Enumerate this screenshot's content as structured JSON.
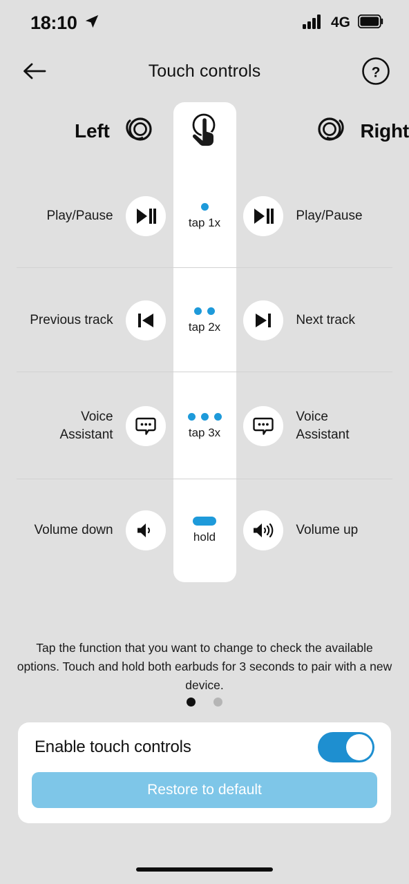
{
  "statusbar": {
    "time": "18:10",
    "location_icon": "location-arrow-icon",
    "signal_icon": "signal-bars-icon",
    "network": "4G",
    "battery_icon": "battery-full-icon"
  },
  "header": {
    "back_icon": "arrow-left-icon",
    "title": "Touch controls",
    "help_icon": "help-circle-icon"
  },
  "earbuds": {
    "left_label": "Left",
    "right_label": "Right",
    "left_icon": "earbud-icon",
    "right_icon": "earbud-icon",
    "gesture_header_icon": "tap-hand-icon"
  },
  "rows": [
    {
      "gesture": "tap 1x",
      "gesture_indicator": "one-blue-dot",
      "left_label": "Play/Pause",
      "left_icon": "play-pause-icon",
      "right_label": "Play/Pause",
      "right_icon": "play-pause-icon"
    },
    {
      "gesture": "tap 2x",
      "gesture_indicator": "two-blue-dots",
      "left_label": "Previous track",
      "left_icon": "previous-track-icon",
      "right_label": "Next track",
      "right_icon": "next-track-icon"
    },
    {
      "gesture": "tap 3x",
      "gesture_indicator": "three-blue-dots",
      "left_label": "Voice Assistant",
      "left_icon": "speech-bubble-icon",
      "right_label": "Voice Assistant",
      "right_icon": "speech-bubble-icon"
    },
    {
      "gesture": "hold",
      "gesture_indicator": "blue-pill",
      "left_label": "Volume down",
      "left_icon": "volume-down-icon",
      "right_label": "Volume up",
      "right_icon": "volume-up-icon"
    }
  ],
  "note": "Tap the function that you want to change to check the available options. Touch and hold both earbuds for 3 seconds to pair with a new device.",
  "pagination": {
    "total": 2,
    "active_index": 0
  },
  "bottom_card": {
    "toggle_label": "Enable touch controls",
    "toggle_on": true,
    "restore_label": "Restore to default"
  },
  "colors": {
    "accent_blue": "#1e9ada",
    "toggle_blue": "#1e8fd0",
    "restore_blue": "#7ec6e8",
    "background": "#e0e0e0",
    "card": "#ffffff"
  }
}
